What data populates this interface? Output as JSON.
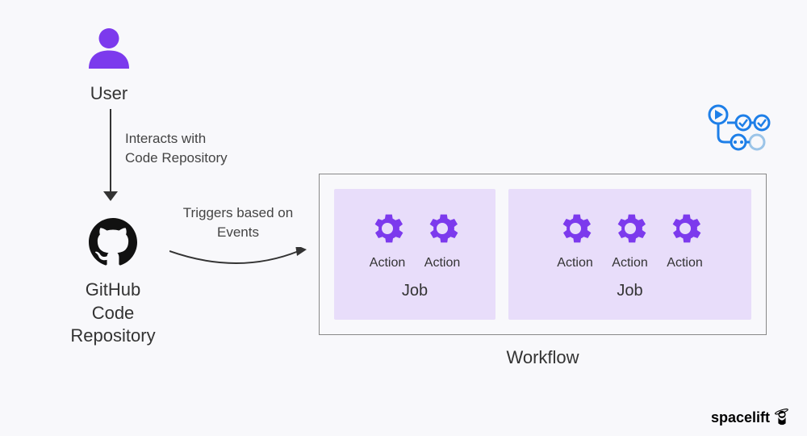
{
  "user": {
    "label": "User"
  },
  "arrow1": {
    "line1": "Interacts with",
    "line2": "Code Repository"
  },
  "github": {
    "line1": "GitHub Code",
    "line2": "Repository"
  },
  "arrow2": {
    "line1": "Triggers based on",
    "line2": "Events"
  },
  "workflow": {
    "label": "Workflow",
    "jobs": [
      {
        "label": "Job",
        "actions": [
          "Action",
          "Action"
        ]
      },
      {
        "label": "Job",
        "actions": [
          "Action",
          "Action",
          "Action"
        ]
      }
    ]
  },
  "brand": "spacelift",
  "colors": {
    "purple": "#7c3aed",
    "blue": "#1e7fe8",
    "lavender": "#e8ddfa"
  }
}
